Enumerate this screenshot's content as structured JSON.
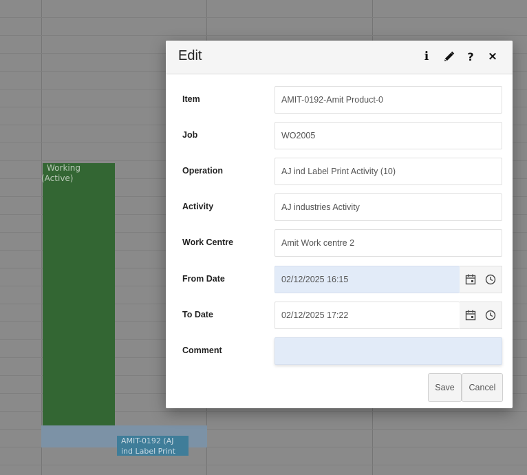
{
  "background": {
    "bar_text_line1": "Working",
    "bar_text_line2": "(Active)",
    "chip_text_line1": "AMIT-0192 (AJ",
    "chip_text_line2": "ind Label Print"
  },
  "dialog": {
    "title": "Edit",
    "header_icons": [
      "info-icon",
      "pencil-icon",
      "help-icon",
      "close-icon"
    ],
    "info_glyph": "i",
    "help_glyph": "?",
    "close_glyph": "×"
  },
  "form": {
    "item": {
      "label": "Item",
      "value": "AMIT-0192-Amit Product-0"
    },
    "job": {
      "label": "Job",
      "value": "WO2005"
    },
    "operation": {
      "label": "Operation",
      "value": "AJ ind Label Print Activity (10)"
    },
    "activity": {
      "label": "Activity",
      "value": "AJ industries Activity"
    },
    "work_centre": {
      "label": "Work Centre",
      "value": "Amit Work centre 2"
    },
    "from_date": {
      "label": "From Date",
      "value": "02/12/2025 16:15"
    },
    "to_date": {
      "label": "To Date",
      "value": "02/12/2025 17:22"
    },
    "comment": {
      "label": "Comment",
      "value": ""
    }
  },
  "buttons": {
    "save": "Save",
    "cancel": "Cancel"
  },
  "colors": {
    "bar": "#336633",
    "highlight_field": "#e2ebf8",
    "overlay": "#8a8a8a"
  }
}
